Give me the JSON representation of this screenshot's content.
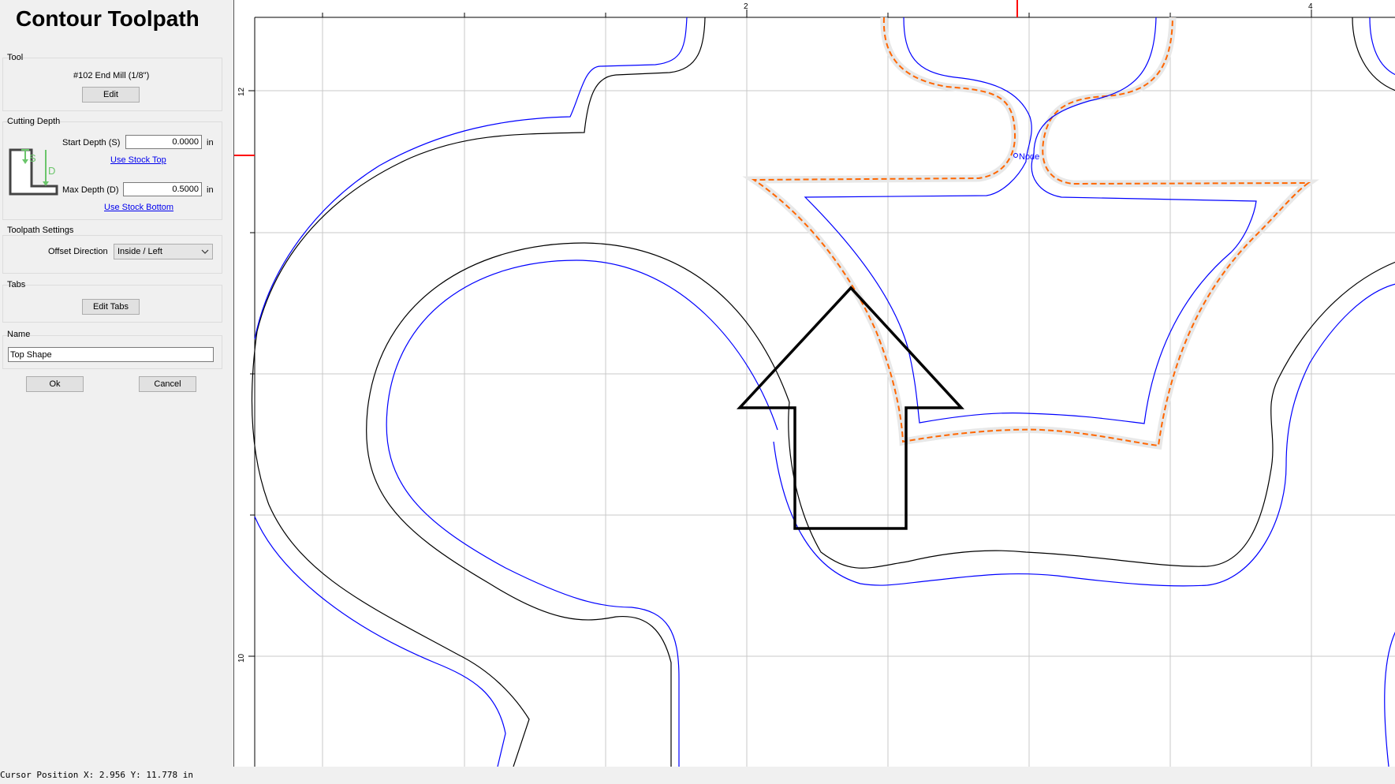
{
  "panel": {
    "title": "Contour Toolpath",
    "tool": {
      "group_title": "Tool",
      "name": "#102 End Mill (1/8\")",
      "edit_label": "Edit"
    },
    "cutting_depth": {
      "group_title": "Cutting Depth",
      "diagram_labels": {
        "s": "S",
        "d": "D"
      },
      "start_label": "Start Depth (S)",
      "start_value": "0.0000",
      "start_unit": "in",
      "use_stock_top": "Use Stock Top",
      "max_label": "Max Depth (D)",
      "max_value": "0.5000",
      "max_unit": "in",
      "use_stock_bottom": "Use Stock Bottom"
    },
    "toolpath_settings": {
      "group_title": "Toolpath Settings",
      "offset_label": "Offset Direction",
      "offset_value": "Inside / Left"
    },
    "tabs": {
      "group_title": "Tabs",
      "edit_tabs_label": "Edit Tabs"
    },
    "name_group": {
      "group_title": "Name",
      "value": "Top Shape"
    },
    "ok_label": "Ok",
    "cancel_label": "Cancel"
  },
  "canvas": {
    "ruler_x_labels": [
      "2",
      "4"
    ],
    "ruler_y_labels": [
      "12",
      "10"
    ],
    "node_label": "Node",
    "colors": {
      "outline": "#000000",
      "toolpath": "#0000ff",
      "selected": "#ff6600",
      "grid": "#c8c8c8",
      "marker": "#ff0000"
    }
  },
  "status": {
    "cursor_text": "Cursor Position X: 2.956  Y: 11.778  in"
  }
}
